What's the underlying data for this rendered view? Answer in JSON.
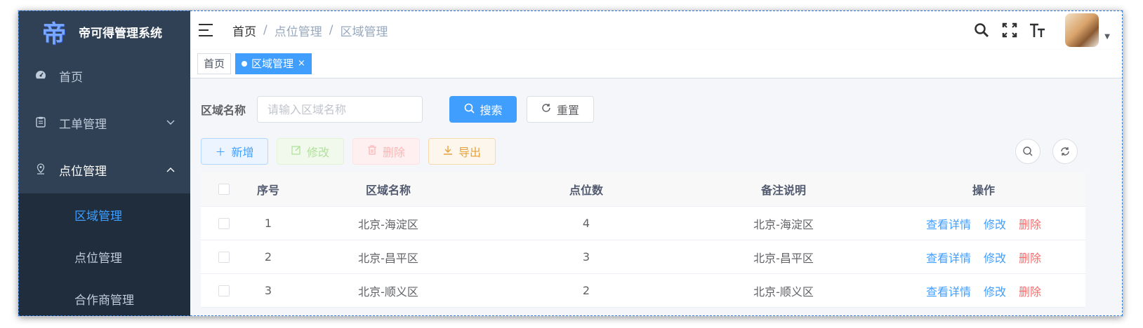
{
  "app": {
    "title": "帝可得管理系统",
    "logo_char": "帝"
  },
  "sidebar": {
    "items": [
      {
        "label": "首页",
        "icon": "dashboard-icon"
      },
      {
        "label": "工单管理",
        "icon": "clipboard-icon",
        "arrow": "﹀"
      },
      {
        "label": "点位管理",
        "icon": "location-pin-icon",
        "arrow": "︿"
      }
    ],
    "subitems": [
      {
        "label": "区域管理",
        "active": true
      },
      {
        "label": "点位管理"
      },
      {
        "label": "合作商管理"
      }
    ]
  },
  "breadcrumb": [
    "首页",
    "点位管理",
    "区域管理"
  ],
  "breadcrumb_sep": "/",
  "tags": {
    "home": "首页",
    "active": "区域管理",
    "close": "×"
  },
  "search": {
    "label": "区域名称",
    "placeholder": "请输入区域名称",
    "value": "",
    "search_button": "搜索",
    "reset_button": "重置"
  },
  "toolbar": {
    "add": "新增",
    "edit": "修改",
    "delete": "删除",
    "export": "导出"
  },
  "table": {
    "headers": [
      "序号",
      "区域名称",
      "点位数",
      "备注说明",
      "操作"
    ],
    "rows": [
      {
        "idx": "1",
        "name": "北京-海淀区",
        "count": "4",
        "note": "北京-海淀区"
      },
      {
        "idx": "2",
        "name": "北京-昌平区",
        "count": "3",
        "note": "北京-昌平区"
      },
      {
        "idx": "3",
        "name": "北京-顺义区",
        "count": "2",
        "note": "北京-顺义区"
      }
    ],
    "ops": {
      "detail": "查看详情",
      "edit": "修改",
      "delete": "删除"
    }
  },
  "colors": {
    "sidebar_bg": "#304156",
    "submenu_bg": "#1f2d3d",
    "primary": "#409eff",
    "danger": "#f56c6c",
    "warning": "#e6a23c"
  }
}
